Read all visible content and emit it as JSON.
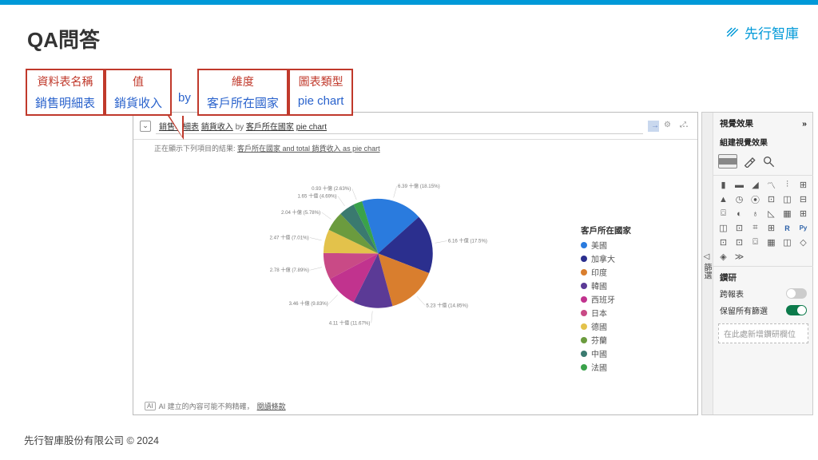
{
  "brand": "先行智庫",
  "title": "QA問答",
  "annotation": {
    "table_label": "資料表名稱",
    "table_value": "銷售明細表",
    "value_label": "值",
    "value_value": "銷貨收入",
    "by": "by",
    "dim_label": "維度",
    "dim_value": "客戶所在國家",
    "charttype_label": "圖表類型",
    "charttype_value": "pie chart"
  },
  "qa_box": {
    "query_parts": [
      "銷售明細表",
      "銷貨收入",
      "by",
      "客戶所在國家",
      "pie chart"
    ],
    "result_text_prefix": "正在顯示下列項目的結果:",
    "result_text_link": "客戶所在國家 and total 銷貨收入 as pie chart",
    "footer_text": "AI 建立的內容可能不夠精確，",
    "footer_link": "閱讀條款"
  },
  "legend_title": "客戶所在國家",
  "chart_data": {
    "type": "pie",
    "title": "",
    "dimension": "客戶所在國家",
    "measure": "銷貨收入",
    "unit": "十億",
    "slices": [
      {
        "label": "美國",
        "value": 6.39,
        "pct": 18.15,
        "color": "#2a7bde"
      },
      {
        "label": "加拿大",
        "value": 6.16,
        "pct": 17.5,
        "color": "#2b2f8e"
      },
      {
        "label": "印度",
        "value": 5.23,
        "pct": 14.85,
        "color": "#d97e2e"
      },
      {
        "label": "韓國",
        "value": 4.11,
        "pct": 11.67,
        "color": "#5b3a96"
      },
      {
        "label": "西班牙",
        "value": 3.46,
        "pct": 9.83,
        "color": "#c1338e"
      },
      {
        "label": "日本",
        "value": 2.78,
        "pct": 7.89,
        "color": "#c94a86"
      },
      {
        "label": "德國",
        "value": 2.47,
        "pct": 7.01,
        "color": "#e3c24b"
      },
      {
        "label": "芬蘭",
        "value": 2.04,
        "pct": 5.78,
        "color": "#6b9b3e"
      },
      {
        "label": "中國",
        "value": 1.65,
        "pct": 4.69,
        "color": "#3a7a6f"
      },
      {
        "label": "法國",
        "value": 0.93,
        "pct": 2.63,
        "color": "#3aa24a"
      }
    ],
    "label_format": "{value} 十億 ({pct}%)"
  },
  "panel": {
    "collapsed_tab1": "篩選",
    "title": "視覺效果",
    "subtitle": "組建視覺效果",
    "section": "鑽研",
    "cross_report": "跨報表",
    "keep_filters": "保留所有篩選",
    "placeholder": "在此處新增鑽研欄位"
  },
  "footer": "先行智庫股份有限公司 © 2024"
}
